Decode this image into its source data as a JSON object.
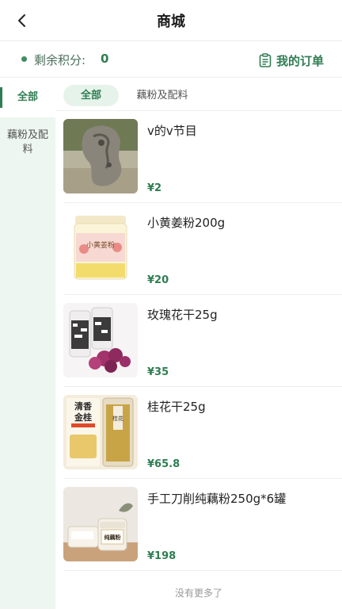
{
  "header": {
    "title": "商城"
  },
  "points": {
    "label": "剩余积分:",
    "value": "0"
  },
  "orders": {
    "label": "我的订单"
  },
  "sidebar": {
    "items": [
      {
        "label": "全部",
        "active": true
      },
      {
        "label_line1": "藕粉及配",
        "label_line2": "料",
        "active": false
      }
    ]
  },
  "subtabs": [
    {
      "label": "全部",
      "active": true
    },
    {
      "label": "藕粉及配料",
      "active": false
    }
  ],
  "products": [
    {
      "name": "v的v节目",
      "price": "¥2"
    },
    {
      "name": "小黄姜粉200g",
      "price": "¥20"
    },
    {
      "name": "玫瑰花干25g",
      "price": "¥35"
    },
    {
      "name": "桂花干25g",
      "price": "¥65.8"
    },
    {
      "name": "手工刀削纯藕粉250g*6罐",
      "price": "¥198"
    }
  ],
  "product_images": {
    "p2_jar_text": "小黄姜粉",
    "p4_top_text_1": "清香",
    "p4_top_text_2": "金桂",
    "p4_jar_text": "桂花",
    "p5_jar_text": "纯藕粉"
  },
  "footer": {
    "no_more": "没有更多了"
  },
  "colors": {
    "accent": "#2f7d52",
    "sidebar_bg": "#edf6f0",
    "subtab_active_bg": "#e6f3ea"
  }
}
